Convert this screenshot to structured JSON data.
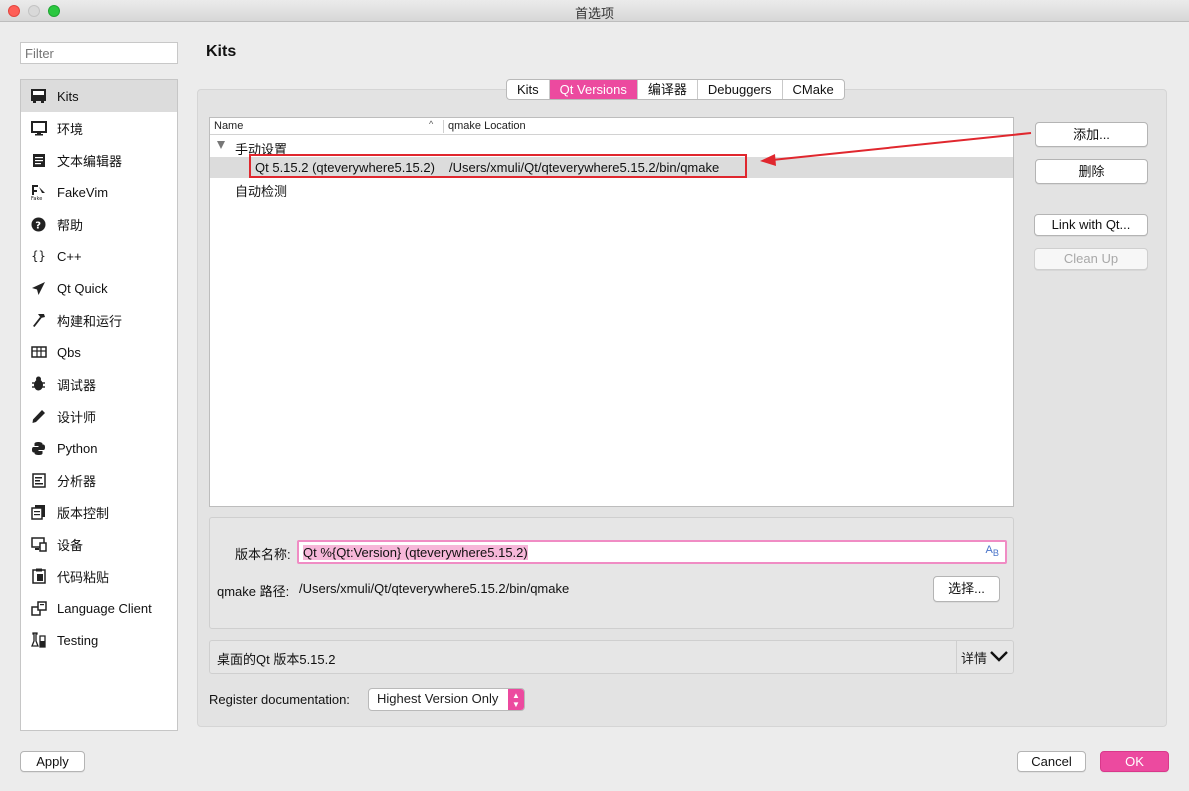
{
  "window": {
    "title": "首选项"
  },
  "filter": {
    "placeholder": "Filter"
  },
  "sidebar": {
    "items": [
      {
        "label": "Kits",
        "icon": "kits-icon",
        "selected": true
      },
      {
        "label": "环境",
        "icon": "monitor-icon"
      },
      {
        "label": "文本编辑器",
        "icon": "text-editor-icon"
      },
      {
        "label": "FakeVim",
        "icon": "fakevim-icon"
      },
      {
        "label": "帮助",
        "icon": "help-icon"
      },
      {
        "label": "C++",
        "icon": "braces-icon"
      },
      {
        "label": "Qt Quick",
        "icon": "paper-plane-icon"
      },
      {
        "label": "构建和运行",
        "icon": "hammer-icon"
      },
      {
        "label": "Qbs",
        "icon": "qbs-icon"
      },
      {
        "label": "调试器",
        "icon": "bug-icon"
      },
      {
        "label": "设计师",
        "icon": "pencil-icon"
      },
      {
        "label": "Python",
        "icon": "python-icon"
      },
      {
        "label": "分析器",
        "icon": "analyzer-icon"
      },
      {
        "label": "版本控制",
        "icon": "version-control-icon"
      },
      {
        "label": "设备",
        "icon": "device-icon"
      },
      {
        "label": "代码粘贴",
        "icon": "clipboard-icon"
      },
      {
        "label": "Language Client",
        "icon": "language-client-icon"
      },
      {
        "label": "Testing",
        "icon": "flask-icon"
      }
    ]
  },
  "main": {
    "title": "Kits",
    "tabs": [
      {
        "label": "Kits"
      },
      {
        "label": "Qt Versions",
        "active": true
      },
      {
        "label": "编译器"
      },
      {
        "label": "Debuggers"
      },
      {
        "label": "CMake"
      }
    ],
    "tree": {
      "columns": {
        "name": "Name",
        "location": "qmake Location"
      },
      "group_manual": "手动设置",
      "selected_row": {
        "name": "Qt 5.15.2 (qteverywhere5.15.2)",
        "location": "/Users/xmuli/Qt/qteverywhere5.15.2/bin/qmake"
      },
      "group_auto": "自动检测"
    },
    "side_buttons": {
      "add": "添加...",
      "remove": "删除",
      "link": "Link with Qt...",
      "cleanup": "Clean Up"
    },
    "details": {
      "version_name_label": "版本名称:",
      "version_name_value": "Qt %{Qt:Version} (qteverywhere5.15.2)",
      "qmake_path_label": "qmake 路径:",
      "qmake_path_value": "/Users/xmuli/Qt/qteverywhere5.15.2/bin/qmake",
      "browse": "选择..."
    },
    "summary": {
      "text": "桌面的Qt 版本5.15.2",
      "details_toggle": "详情"
    },
    "register_doc": {
      "label": "Register documentation:",
      "value": "Highest Version Only"
    }
  },
  "footer": {
    "apply": "Apply",
    "cancel": "Cancel",
    "ok": "OK"
  },
  "colors": {
    "accent": "#ec4a9f",
    "annotation": "#e0272e"
  }
}
